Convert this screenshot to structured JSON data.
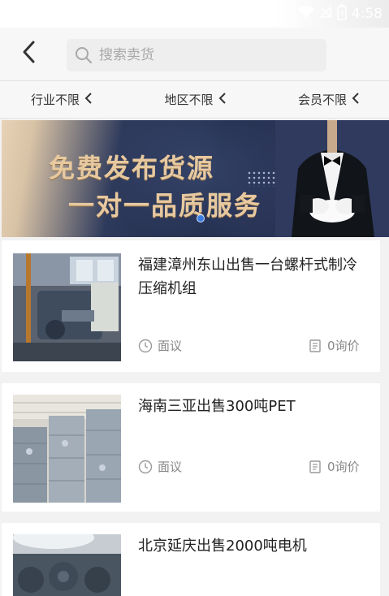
{
  "status": {
    "time": "4:58"
  },
  "header": {
    "search_placeholder": "搜索卖货"
  },
  "filters": [
    {
      "label": "行业不限"
    },
    {
      "label": "地区不限"
    },
    {
      "label": "会员不限"
    }
  ],
  "banner": {
    "line1": "免费发布货源",
    "line2": "一对一品质服务"
  },
  "listings": [
    {
      "title": "福建漳州东山出售一台螺杆式制冷压缩机组",
      "price": "面议",
      "inquiries": "0询价"
    },
    {
      "title": "海南三亚出售300吨PET",
      "price": "面议",
      "inquiries": "0询价"
    },
    {
      "title": "北京延庆出售2000吨电机"
    }
  ],
  "colors": {
    "accent": "#3b7ee0",
    "banner_text": "#e7c9a0",
    "banner_bg": "#1f2a48"
  }
}
